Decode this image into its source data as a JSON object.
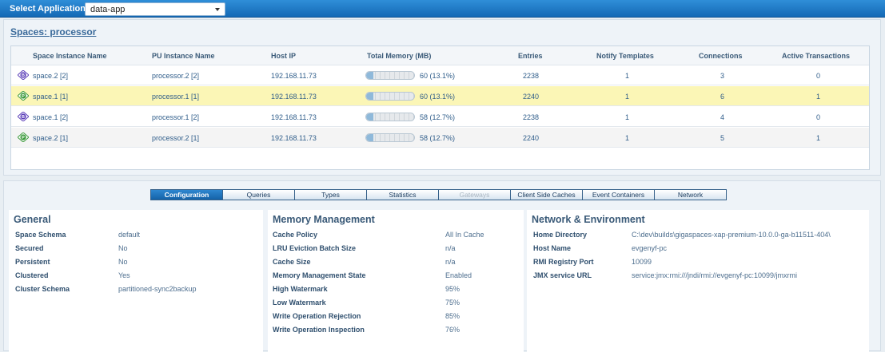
{
  "topbar": {
    "label": "Select Application:",
    "app_value": "data-app"
  },
  "spaces": {
    "title": "Spaces: processor",
    "columns": [
      "Space Instance Name",
      "PU Instance Name",
      "Host IP",
      "Total Memory (MB)",
      "Entries",
      "Notify Templates",
      "Connections",
      "Active Transactions"
    ],
    "rows": [
      {
        "icon": "backup-space-icon",
        "space": "space.2 [2]",
        "pu": "processor.2 [2]",
        "host": "192.168.11.73",
        "memory": "60 (13.1%)",
        "memory_pct": 13.1,
        "entries": "2238",
        "notify": "1",
        "connections": "3",
        "transactions": "0"
      },
      {
        "icon": "primary-space-icon",
        "space": "space.1 [1]",
        "pu": "processor.1 [1]",
        "host": "192.168.11.73",
        "memory": "60 (13.1%)",
        "memory_pct": 13.1,
        "entries": "2240",
        "notify": "1",
        "connections": "6",
        "transactions": "1"
      },
      {
        "icon": "backup-space-icon",
        "space": "space.1 [2]",
        "pu": "processor.1 [2]",
        "host": "192.168.11.73",
        "memory": "58 (12.7%)",
        "memory_pct": 12.7,
        "entries": "2238",
        "notify": "1",
        "connections": "4",
        "transactions": "0"
      },
      {
        "icon": "primary-space-icon",
        "space": "space.2 [1]",
        "pu": "processor.2 [1]",
        "host": "192.168.11.73",
        "memory": "58 (12.7%)",
        "memory_pct": 12.7,
        "entries": "2240",
        "notify": "1",
        "connections": "5",
        "transactions": "1"
      }
    ],
    "selected_row": 1
  },
  "tabs": [
    "Configuration",
    "Queries",
    "Types",
    "Statistics",
    "Gateways",
    "Client Side Caches",
    "Event Containers",
    "Network"
  ],
  "active_tab": "Configuration",
  "disabled_tab": "Gateways",
  "general": {
    "title": "General",
    "items": [
      {
        "k": "Space Schema",
        "v": "default"
      },
      {
        "k": "Secured",
        "v": "No"
      },
      {
        "k": "Persistent",
        "v": "No"
      },
      {
        "k": "Clustered",
        "v": "Yes"
      },
      {
        "k": "Cluster Schema",
        "v": "partitioned-sync2backup"
      }
    ]
  },
  "memory": {
    "title": "Memory Management",
    "items": [
      {
        "k": "Cache Policy",
        "v": "All In Cache"
      },
      {
        "k": "LRU Eviction Batch Size",
        "v": "n/a"
      },
      {
        "k": "Cache Size",
        "v": "n/a"
      },
      {
        "k": "Memory Management State",
        "v": "Enabled"
      },
      {
        "k": "High Watermark",
        "v": "95%"
      },
      {
        "k": "Low Watermark",
        "v": "75%"
      },
      {
        "k": "Write Operation Rejection",
        "v": "85%"
      },
      {
        "k": "Write Operation Inspection",
        "v": "76%"
      }
    ]
  },
  "network": {
    "title": "Network & Environment",
    "items": [
      {
        "k": "Home Directory",
        "v": "C:\\dev\\builds\\gigaspaces-xap-premium-10.0.0-ga-b11511-404\\"
      },
      {
        "k": "Host Name",
        "v": "evgenyf-pc"
      },
      {
        "k": "RMI Registry Port",
        "v": "10099"
      },
      {
        "k": "JMX service URL",
        "v": "service:jmx:rmi:///jndi/rmi://evgenyf-pc:10099/jmxrmi"
      }
    ]
  },
  "colors": {
    "accent": "#1a72c0",
    "selected_row": "#fbf6b6",
    "backup_icon": "#5a3db8",
    "primary_icon": "#3c9a3c"
  }
}
